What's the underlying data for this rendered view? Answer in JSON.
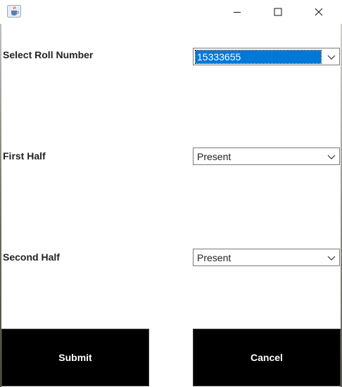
{
  "window": {
    "icon": "java-cup-icon",
    "controls": {
      "minimize": "minimize-icon",
      "maximize": "maximize-icon",
      "close": "close-icon"
    }
  },
  "form": {
    "roll_label": "Select Roll Number",
    "roll_value": "15333655",
    "first_half_label": "First Half",
    "first_half_value": "Present",
    "second_half_label": "Second Half",
    "second_half_value": "Present"
  },
  "buttons": {
    "submit": "Submit",
    "cancel": "Cancel"
  },
  "colors": {
    "selection": "#0078d7",
    "button_bg": "#000000",
    "button_text": "#ffffff"
  }
}
